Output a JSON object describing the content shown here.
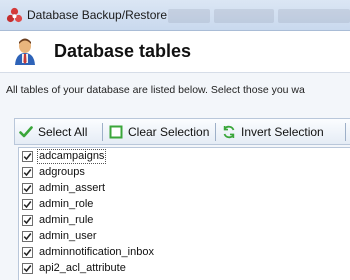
{
  "window": {
    "title": "Database Backup/Restore",
    "icon": "app-logo-icon"
  },
  "header": {
    "title": "Database tables",
    "icon": "database-user-icon"
  },
  "description": "All tables of your database are listed below. Select those you wa",
  "toolbar": {
    "select_all": "Select All",
    "clear_selection": "Clear Selection",
    "invert_selection": "Invert Selection"
  },
  "tables": [
    {
      "name": "adcampaigns",
      "checked": true
    },
    {
      "name": "adgroups",
      "checked": true
    },
    {
      "name": "admin_assert",
      "checked": true
    },
    {
      "name": "admin_role",
      "checked": true
    },
    {
      "name": "admin_rule",
      "checked": true
    },
    {
      "name": "admin_user",
      "checked": true
    },
    {
      "name": "adminnotification_inbox",
      "checked": true
    },
    {
      "name": "api2_acl_attribute",
      "checked": true
    }
  ],
  "colors": {
    "check_green": "#3aa63a",
    "titlebar": "#c9d9ee",
    "content_bg": "#f3f6fa"
  }
}
